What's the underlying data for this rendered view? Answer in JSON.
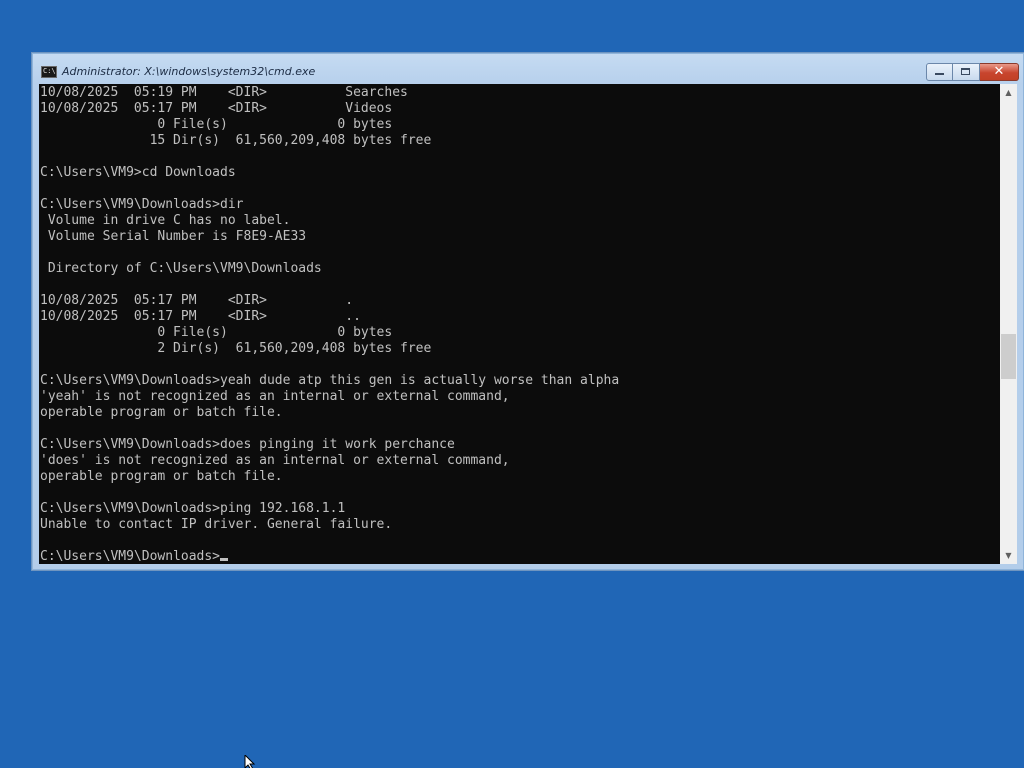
{
  "window": {
    "title": "Administrator: X:\\windows\\system32\\cmd.exe",
    "icon": "cmd-icon",
    "icon_text": "C:\\",
    "controls": {
      "minimize": "minimize-icon",
      "maximize": "maximize-icon",
      "close": "close-icon",
      "close_glyph": "✕"
    }
  },
  "console": {
    "lines": [
      "10/08/2025  05:19 PM    <DIR>          Searches",
      "10/08/2025  05:17 PM    <DIR>          Videos",
      "               0 File(s)              0 bytes",
      "              15 Dir(s)  61,560,209,408 bytes free",
      "",
      "C:\\Users\\VM9>cd Downloads",
      "",
      "C:\\Users\\VM9\\Downloads>dir",
      " Volume in drive C has no label.",
      " Volume Serial Number is F8E9-AE33",
      "",
      " Directory of C:\\Users\\VM9\\Downloads",
      "",
      "10/08/2025  05:17 PM    <DIR>          .",
      "10/08/2025  05:17 PM    <DIR>          ..",
      "               0 File(s)              0 bytes",
      "               2 Dir(s)  61,560,209,408 bytes free",
      "",
      "C:\\Users\\VM9\\Downloads>yeah dude atp this gen is actually worse than alpha",
      "'yeah' is not recognized as an internal or external command,",
      "operable program or batch file.",
      "",
      "C:\\Users\\VM9\\Downloads>does pinging it work perchance",
      "'does' is not recognized as an internal or external command,",
      "operable program or batch file.",
      "",
      "C:\\Users\\VM9\\Downloads>ping 192.168.1.1",
      "Unable to contact IP driver. General failure.",
      ""
    ],
    "prompt": "C:\\Users\\VM9\\Downloads>",
    "colors": {
      "background": "#0c0c0c",
      "foreground": "#c0c0c0"
    }
  },
  "scrollbar": {
    "up_icon": "scroll-up-arrow-icon",
    "down_icon": "scroll-down-arrow-icon",
    "up_glyph": "▲",
    "down_glyph": "▼",
    "position_fraction": 0.58
  },
  "desktop": {
    "background": "#2066b6",
    "cursor_icon": "mouse-pointer-icon"
  }
}
